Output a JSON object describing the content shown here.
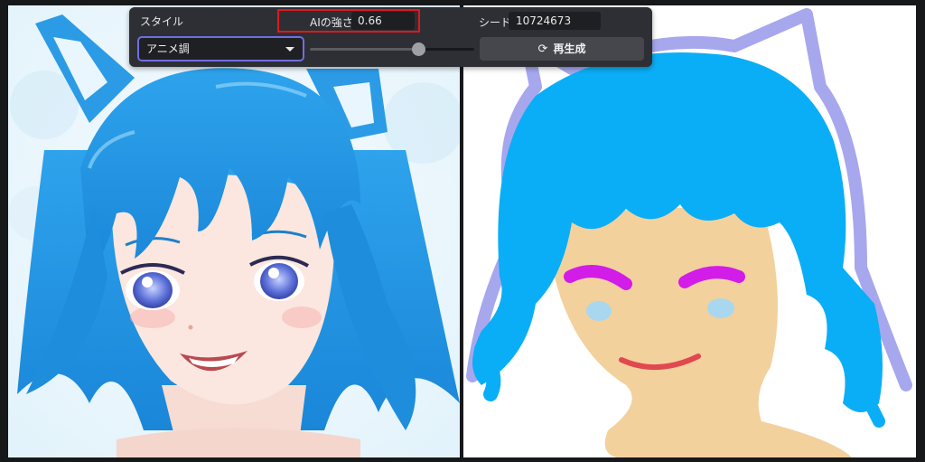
{
  "toolbar": {
    "style_label": "スタイル",
    "style_select": {
      "value": "アニメ調"
    },
    "strength_label": "AIの強さ",
    "strength_value": "0.66",
    "strength_slider": {
      "value": 0.66,
      "min": 0,
      "max": 1
    },
    "seed_label": "シード",
    "seed_value": "10724673",
    "regenerate_label": "再生成",
    "regenerate_icon": "refresh-icon"
  },
  "colors": {
    "highlight_border": "#e0171f",
    "select_border": "#6f6fe0",
    "panel_bg": "#2d2f34"
  }
}
